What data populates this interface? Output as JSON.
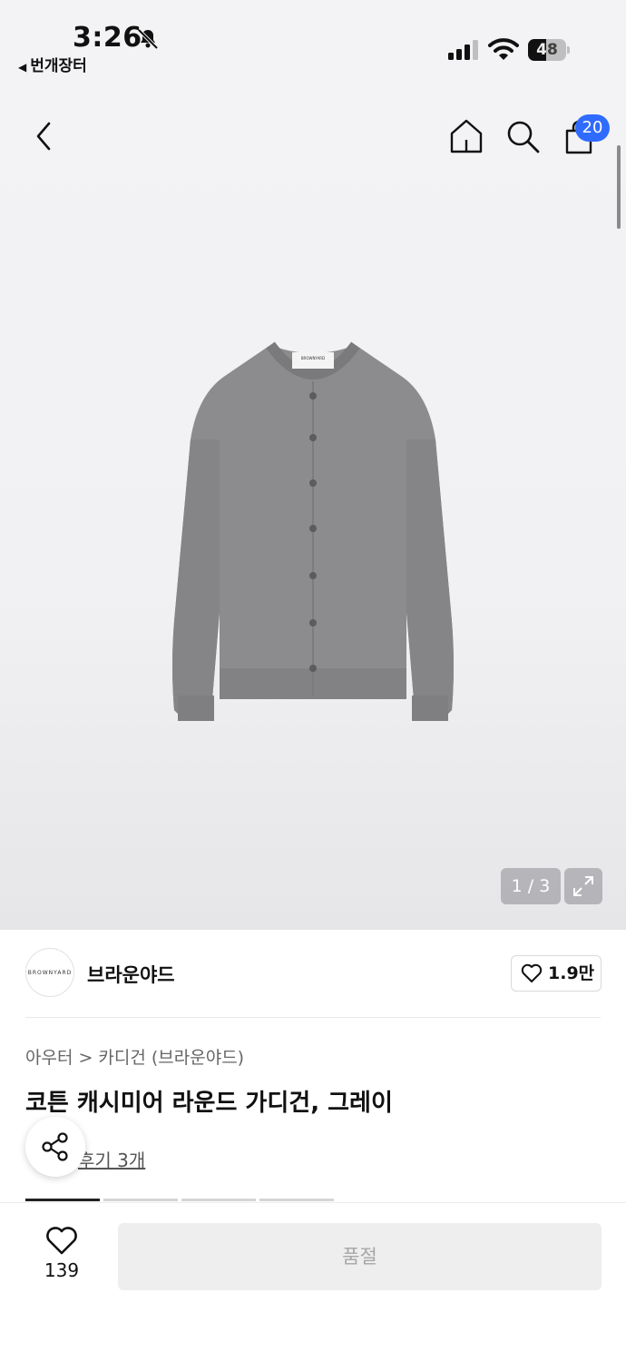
{
  "status_bar": {
    "time": "3:26",
    "back_app": "번개장터",
    "battery_level": "48",
    "battery_fraction": 0.48
  },
  "nav": {
    "cart_count": "20"
  },
  "gallery": {
    "counter": "1 / 3",
    "brand_label_on_garment": "BROWNYARD"
  },
  "brand": {
    "logo_text": "BROWNYARD",
    "name": "브라운야드",
    "likes": "1.9만"
  },
  "product": {
    "breadcrumb": [
      "아우터",
      "카디건 (브라운야드)"
    ],
    "breadcrumb_sep": ">",
    "title": "코튼 캐시미어 라운드 가디건, 그레이",
    "review_text": "후기 3개"
  },
  "bottom_bar": {
    "wish_count": "139",
    "action_label": "품절"
  },
  "colors": {
    "accent": "#2f6bff",
    "background": "#f3f3f5",
    "disabled_button": "#eeeeef",
    "disabled_text": "#a6a6a6"
  }
}
